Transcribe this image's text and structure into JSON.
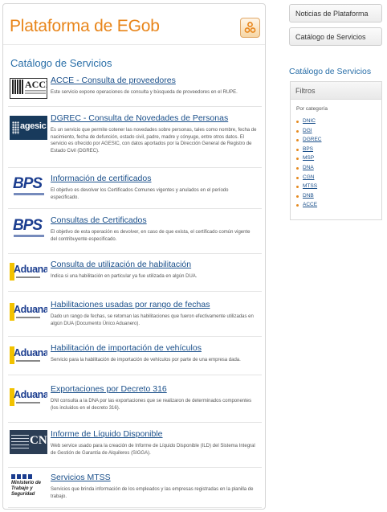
{
  "header": {
    "site_title": "Plataforma de EGob"
  },
  "main": {
    "section_title": "Catálogo de Servicios",
    "items": [
      {
        "logo": "acce-logo",
        "logo_text": "ACCE",
        "title": "ACCE - Consulta de proveedores",
        "description": "Este servicio expone operaciones de consulta y búsqueda de proveedores en el RUPE."
      },
      {
        "logo": "agesic-logo",
        "logo_text": "agesic",
        "title": "DGREC - Consulta de Novedades de Personas",
        "description": "Es un servicio que permite cotener las novedades sobre personas, tales como nombre, fecha de nacimiento, fecha de defunción, estado civil, padre, madre y cónyuge, entre otros datos. El servicio es ofrecido por AGESIC, con datos aportados por la Dirección General de Registro de Estado Civil (DGREC)."
      },
      {
        "logo": "bps-logo",
        "logo_text": "BPS",
        "title": "Información de certificados",
        "description": "El objetivo es devolver los Certificados Comunes vigentes y anulados en el período especificado."
      },
      {
        "logo": "bps-logo",
        "logo_text": "BPS",
        "title": "Consultas de Certificados",
        "description": "El objetivo de esta operación es devolver, en caso de que exista, el certificado común vigente del contribuyente especificado."
      },
      {
        "logo": "aduanas-logo",
        "logo_text": "Aduanas",
        "title": "Consulta de utilización de habilitación",
        "description": "Indica si una habilitación en particular ya fue utilizada en algún DUA."
      },
      {
        "logo": "aduanas-logo",
        "logo_text": "Aduanas",
        "title": "Habilitaciones usadas por rango de fechas",
        "description": "Dado un rango de fechas, se retornan las habilitaciones que fueron efectivamente utilizadas en algún DUA (Documento Único Aduanero)."
      },
      {
        "logo": "aduanas-logo",
        "logo_text": "Aduanas",
        "title": "Habilitación de importación de vehículos",
        "description": "Servicio para la habilitación de importación de vehículos por parte de una empresa dada."
      },
      {
        "logo": "aduanas-logo",
        "logo_text": "Aduanas",
        "title": "Exportaciones por Decreto 316",
        "description": "DNI consulta a la DNA por las exportaciones que se realizaron de determinados componentes (los incluidos en el decreto 316)."
      },
      {
        "logo": "cgn-logo",
        "logo_text": "CN",
        "title": "Informe de Líquido Disponible",
        "description": "Web service usado para la creación de Informe de Líquido Disponible (ILD) del Sistema Integral de Gestión de Garantía de Alquileres (SIGGA)."
      },
      {
        "logo": "mtss-logo",
        "logo_text": "Ministerio de Trabajo y Seguridad Social",
        "title": "Servicios MTSS",
        "description": "Servicios que brinda información de los empleados y las empresas registradas en la planilla de trabajo."
      }
    ]
  },
  "sidebar": {
    "buttons": [
      "Noticias de Plataforma",
      "Catálogo de Servicios"
    ],
    "title": "Catálogo de Servicios",
    "filters_header": "Filtros",
    "filters_sub": "Por categoría",
    "categories": [
      "DNIC",
      "DGI",
      "DGREC",
      "BPS",
      "MSP",
      "DNA",
      "CGN",
      "MTSS",
      "DNB",
      "ACCE"
    ]
  },
  "colors": {
    "title_orange": "#e8851a",
    "link_blue": "#1a4f8a",
    "section_blue": "#2a6fa8",
    "bullet_orange": "#e58a1f"
  }
}
